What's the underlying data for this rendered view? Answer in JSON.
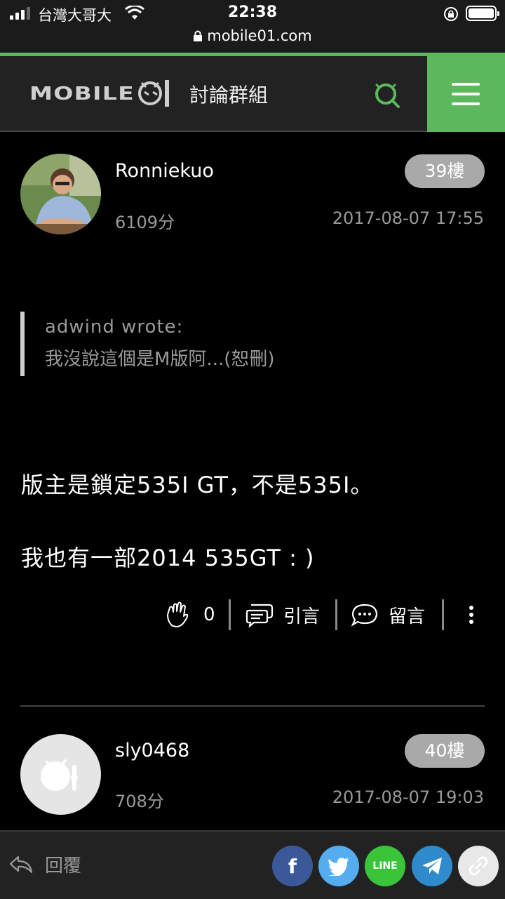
{
  "status_bar": {
    "carrier": "台灣大哥大",
    "time": "22:38",
    "url": "mobile01.com"
  },
  "header": {
    "logo_text": "MOBILE01",
    "title": "討論群組",
    "accent_color": "#5cb85c"
  },
  "posts": [
    {
      "username": "Ronniekuo",
      "floor": "39樓",
      "score": "6109分",
      "timestamp": "2017-08-07 17:55",
      "quote": {
        "author": "adwind wrote:",
        "text": "我沒說這個是M版阿...(恕刪)"
      },
      "body": [
        "版主是鎖定535I GT，不是535I。",
        "我也有一部2014 535GT : )"
      ],
      "actions": {
        "like_count": "0",
        "quote_label": "引言",
        "comment_label": "留言"
      }
    },
    {
      "username": "sly0468",
      "floor": "40樓",
      "score": "708分",
      "timestamp": "2017-08-07 19:03"
    }
  ],
  "bottom_bar": {
    "reply_label": "回覆",
    "share_buttons": [
      {
        "name": "facebook",
        "label": "f",
        "color": "#3b5998"
      },
      {
        "name": "twitter",
        "color": "#55acee"
      },
      {
        "name": "line",
        "label": "LINE",
        "color": "#3ac43a"
      },
      {
        "name": "telegram",
        "color": "#2f8bcc"
      },
      {
        "name": "link",
        "color": "#e8e8e8"
      }
    ]
  }
}
